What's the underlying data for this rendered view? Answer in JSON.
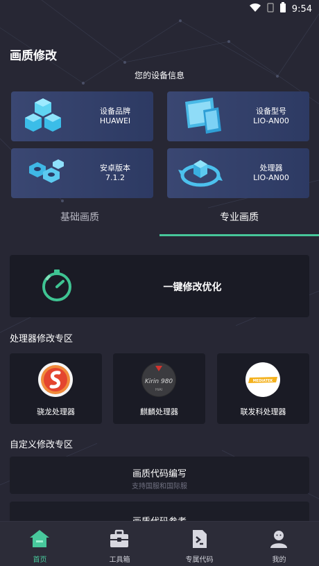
{
  "status_bar": {
    "time": "9:54"
  },
  "page": {
    "title": "画质修改",
    "device_section": "您的设备信息"
  },
  "device_info": [
    {
      "label": "设备品牌",
      "value": "HUAWEI",
      "icon": "cubes-icon"
    },
    {
      "label": "设备型号",
      "value": "LIO-AN00",
      "icon": "devices-icon"
    },
    {
      "label": "安卓版本",
      "value": "7.1.2",
      "icon": "hex-nuts-icon"
    },
    {
      "label": "处理器",
      "value": "LIO-AN00",
      "icon": "refresh-chip-icon"
    }
  ],
  "tabs": [
    {
      "label": "基础画质",
      "active": false
    },
    {
      "label": "专业画质",
      "active": true
    }
  ],
  "one_key": {
    "label": "一键修改优化",
    "icon": "timer-icon"
  },
  "cpu_section": {
    "title": "处理器修改专区",
    "items": [
      {
        "name": "骁龙处理器",
        "icon": "snapdragon-logo"
      },
      {
        "name": "麒麟处理器",
        "icon": "kirin-logo",
        "chip_text": "Kirin 980",
        "chip_sub": "HiAI"
      },
      {
        "name": "联发科处理器",
        "icon": "mediatek-logo",
        "chip_text": "MEDIATEK"
      }
    ]
  },
  "custom_section": {
    "title": "自定义修改专区",
    "cards": [
      {
        "title": "画质代码编写",
        "subtitle": "支持国服和国际服"
      },
      {
        "title": "画质代码参考",
        "subtitle": ""
      }
    ]
  },
  "bottom_nav": [
    {
      "label": "首页",
      "icon": "home-icon",
      "active": true
    },
    {
      "label": "工具箱",
      "icon": "toolbox-icon",
      "active": false
    },
    {
      "label": "专属代码",
      "icon": "terminal-icon",
      "active": false
    },
    {
      "label": "我的",
      "icon": "user-icon",
      "active": false
    }
  ],
  "colors": {
    "accent": "#47c79a",
    "card_blue": "#34426b",
    "background": "#272734"
  }
}
